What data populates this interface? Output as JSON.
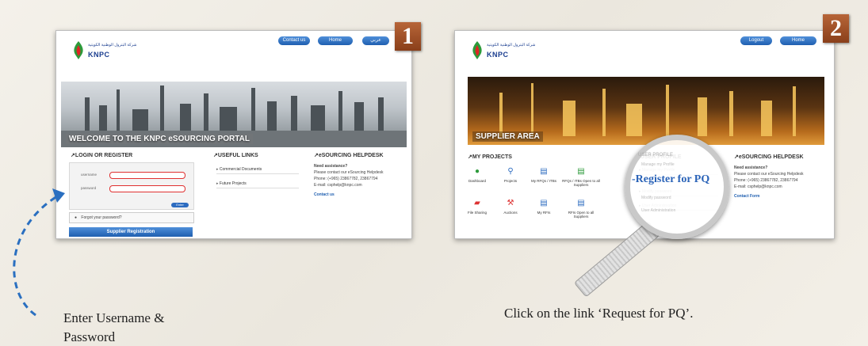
{
  "screen1": {
    "nav_buttons": [
      "Contact us",
      "Home",
      "عربي"
    ],
    "logo": {
      "brand": "KNPC",
      "arabic": "شركة البترول الوطنية الكويتية"
    },
    "banner_title": "WELCOME TO THE KNPC eSOURCING PORTAL",
    "login": {
      "heading": "LOGIN OR REGISTER",
      "username_label": "username",
      "password_label": "password",
      "enter_label": "Enter",
      "forgot": "Forgot your password?",
      "supplier_registration": "Supplier Registration"
    },
    "useful_links": {
      "heading": "USEFUL LINKS",
      "items": [
        "Commercial Documents",
        "Future Projects"
      ]
    },
    "helpdesk": {
      "heading": "eSOURCING HELPDESK",
      "need": "Need assistance?",
      "line1": "Please contact our eSourcing Helpdesk",
      "phone": "Phone: (+965) 23867782, 23867794",
      "email": "E-mail: csphelp@knpc.com",
      "contact": "Contact us"
    },
    "step": "1"
  },
  "screen2": {
    "nav_buttons": [
      "Logout",
      "Home"
    ],
    "logo": {
      "brand": "KNPC",
      "arabic": "شركة البترول الوطنية الكويتية"
    },
    "banner_title": "SUPPLIER AREA",
    "projects": {
      "heading": "MY PROJECTS",
      "items": [
        "Dashboard",
        "Projects",
        "My RFQs / ITBs",
        "RFQs / ITBs Open to all Suppliers",
        "File Sharing",
        "Auctions",
        "My RFIs",
        "RFIs Open to all Suppliers"
      ]
    },
    "profile": {
      "heading": "USER PROFILE",
      "items": [
        "Manage my Profile",
        "Register for PQ",
        "Modify password",
        "User Administration"
      ]
    },
    "helpdesk": {
      "heading": "eSOURCING HELPDESK",
      "need": "Need assistance?",
      "line1": "Please contact our eSourcing Helpdesk",
      "phone": "Phone: (+965) 23867782, 23867794",
      "email": "E-mail: csphelp@knpc.com",
      "contact": "Contact Form"
    },
    "step": "2"
  },
  "captions": {
    "left": "Enter Username &",
    "left2": "Password",
    "right": "Click on the link ‘Request for PQ’."
  },
  "colors": {
    "accent_blue": "#1f5fb0",
    "highlight_red": "#e03030",
    "badge": "#a04f28"
  }
}
